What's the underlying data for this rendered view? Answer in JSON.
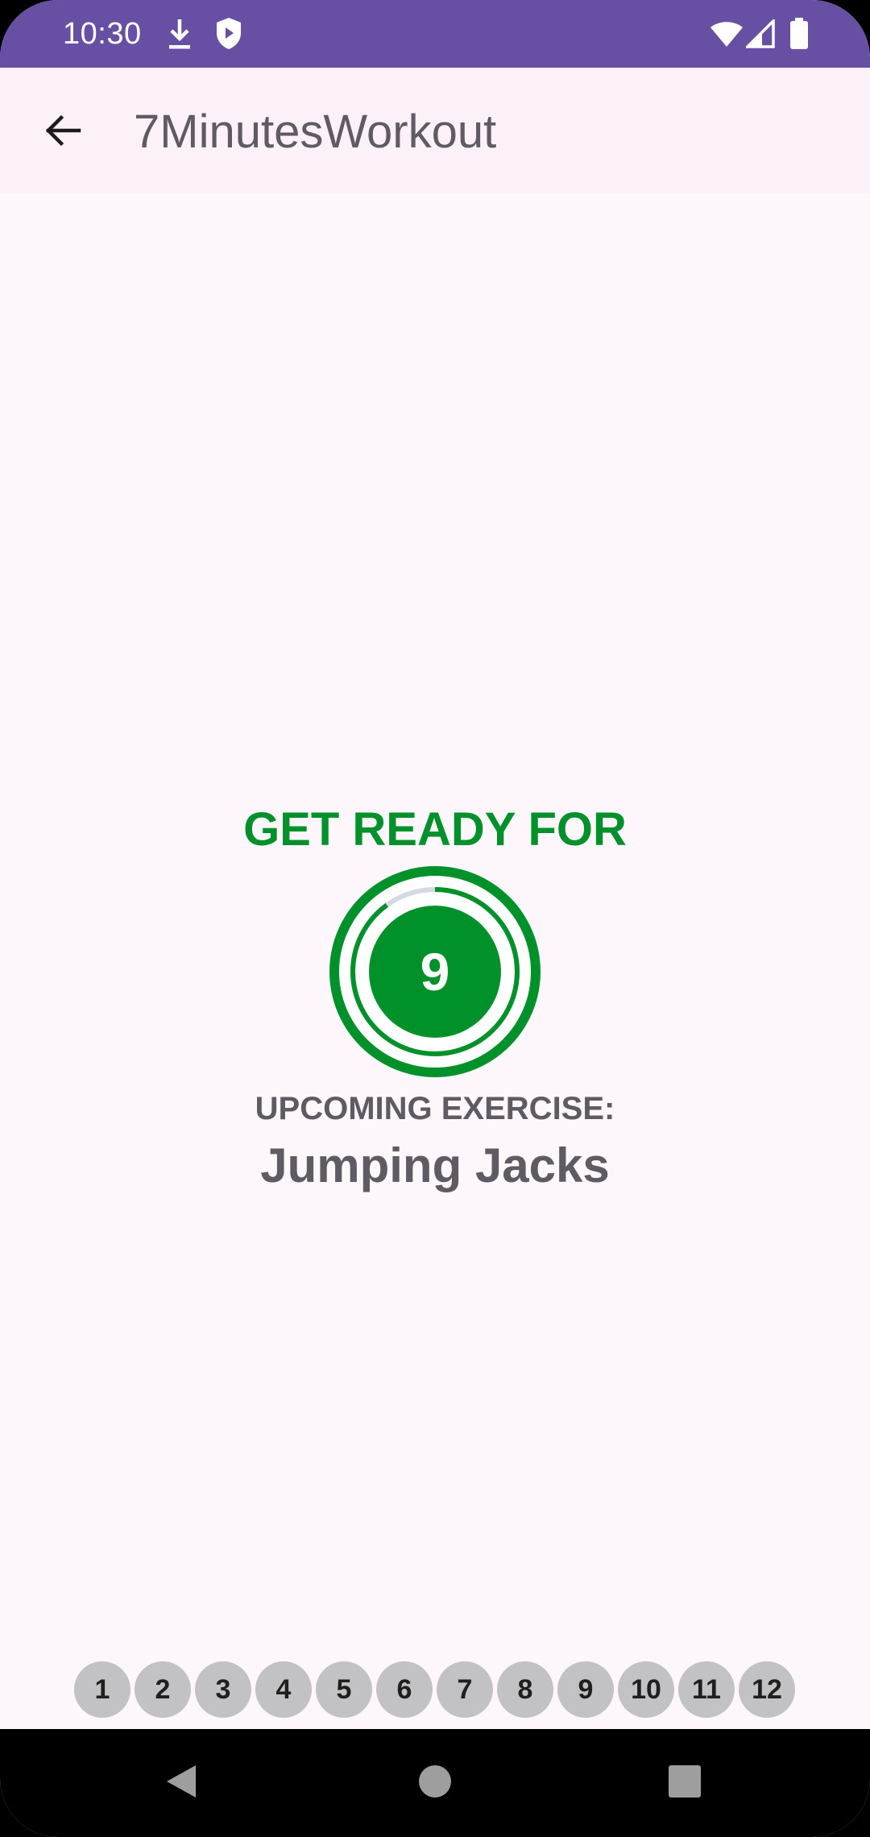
{
  "status_bar": {
    "time": "10:30",
    "icons": [
      "download-icon",
      "shield-play-icon",
      "wifi-icon",
      "signal-icon",
      "battery-icon"
    ]
  },
  "app_bar": {
    "back_icon": "arrow-back-icon",
    "title": "7MinutesWorkout"
  },
  "main": {
    "heading": "GET READY FOR",
    "timer_value": "9",
    "timer_progress": 0.9,
    "upcoming_label": "UPCOMING EXERCISE:",
    "exercise_name": "Jumping Jacks"
  },
  "progress_steps": [
    "1",
    "2",
    "3",
    "4",
    "5",
    "6",
    "7",
    "8",
    "9",
    "10",
    "11",
    "12"
  ],
  "nav_bar": {
    "buttons": [
      "back-triangle-icon",
      "home-circle-icon",
      "recents-square-icon"
    ]
  },
  "colors": {
    "status_bar": "#6750a4",
    "accent_green": "#00912a",
    "text_gray": "#5f5a63",
    "step_gray": "#c2c1c3",
    "background": "#fdf6fb"
  }
}
